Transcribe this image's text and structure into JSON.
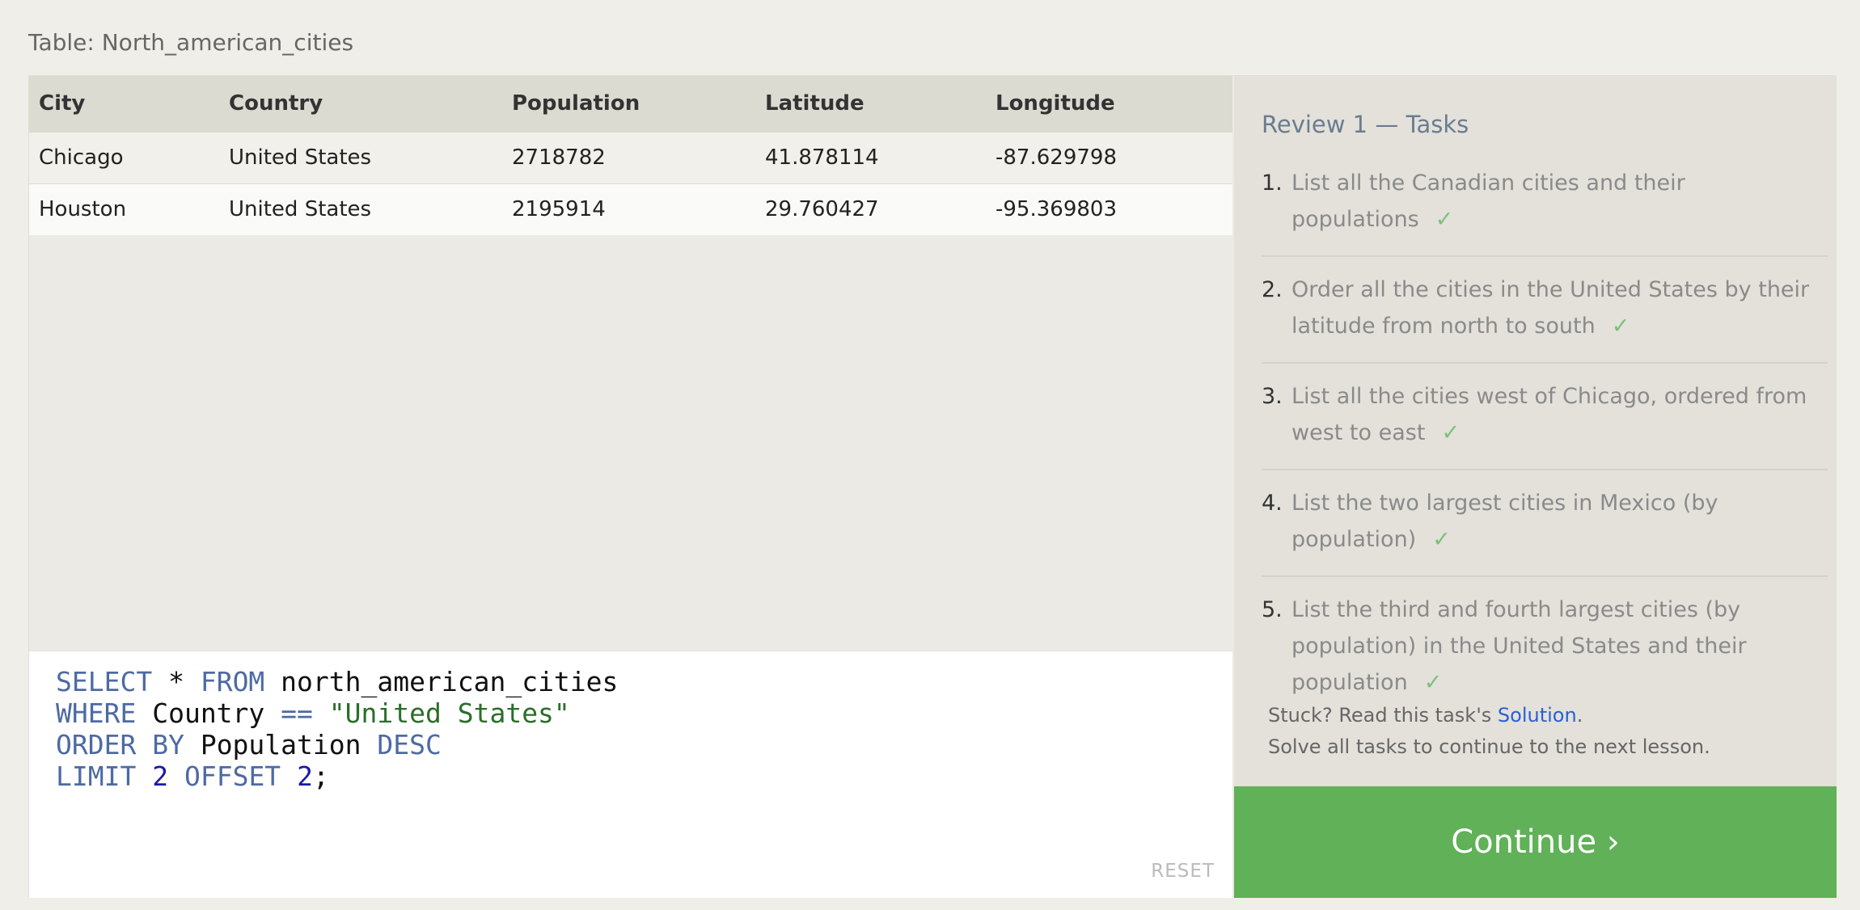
{
  "table_caption": "Table: North_american_cities",
  "results": {
    "columns": [
      "City",
      "Country",
      "Population",
      "Latitude",
      "Longitude"
    ],
    "rows": [
      [
        "Chicago",
        "United States",
        "2718782",
        "41.878114",
        "-87.629798"
      ],
      [
        "Houston",
        "United States",
        "2195914",
        "29.760427",
        "-95.369803"
      ]
    ]
  },
  "editor": {
    "lines": [
      [
        {
          "t": "SELECT",
          "c": "kw"
        },
        {
          "t": " * ",
          "c": ""
        },
        {
          "t": "FROM",
          "c": "kw"
        },
        {
          "t": " north_american_cities",
          "c": ""
        }
      ],
      [
        {
          "t": "WHERE",
          "c": "kw"
        },
        {
          "t": " Country ",
          "c": ""
        },
        {
          "t": "==",
          "c": "kw"
        },
        {
          "t": " ",
          "c": ""
        },
        {
          "t": "\"United States\"",
          "c": "str"
        }
      ],
      [
        {
          "t": "ORDER BY",
          "c": "kw"
        },
        {
          "t": " Population ",
          "c": ""
        },
        {
          "t": "DESC",
          "c": "kw"
        }
      ],
      [
        {
          "t": "LIMIT",
          "c": "kw"
        },
        {
          "t": " ",
          "c": ""
        },
        {
          "t": "2",
          "c": "num"
        },
        {
          "t": " ",
          "c": ""
        },
        {
          "t": "OFFSET",
          "c": "kw"
        },
        {
          "t": " ",
          "c": ""
        },
        {
          "t": "2",
          "c": "num"
        },
        {
          "t": ";",
          "c": ""
        }
      ]
    ],
    "reset_label": "RESET"
  },
  "tasks": {
    "title": "Review 1 — Tasks",
    "items": [
      {
        "num": "1.",
        "text": "List all the Canadian cities and their populations",
        "check": "✓"
      },
      {
        "num": "2.",
        "text": "Order all the cities in the United States by their latitude from north to south",
        "check": "✓"
      },
      {
        "num": "3.",
        "text": "List all the cities west of Chicago, ordered from west to east",
        "check": "✓"
      },
      {
        "num": "4.",
        "text": "List the two largest cities in Mexico (by population)",
        "check": "✓"
      },
      {
        "num": "5.",
        "text": "List the third and fourth largest cities (by population) in the United States and their population",
        "check": "✓"
      }
    ]
  },
  "help": {
    "stuck_prefix": "Stuck? Read this task's ",
    "solution_link": "Solution",
    "stuck_suffix": ".",
    "note": "Solve all tasks to continue to the next lesson."
  },
  "continue_label": "Continue ›"
}
